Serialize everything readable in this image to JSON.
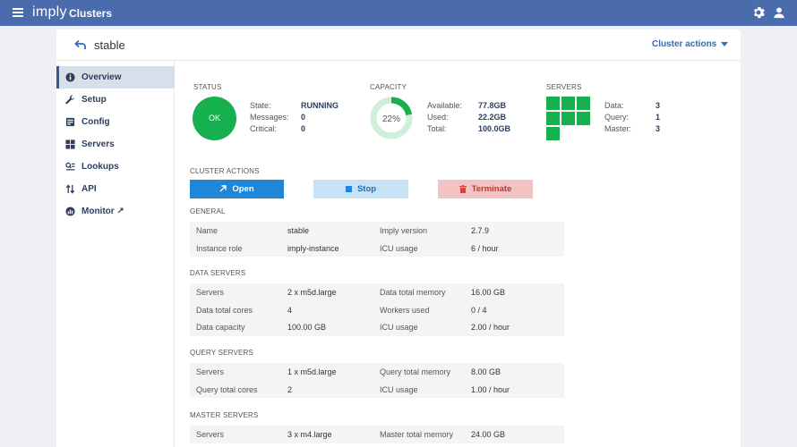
{
  "topbar": {
    "brand": "imply",
    "title": "Clusters",
    "bg": "#4a6bac"
  },
  "header": {
    "cluster_name": "stable",
    "cluster_actions_label": "Cluster actions"
  },
  "sidebar": {
    "items": [
      {
        "label": "Overview",
        "icon": "info-icon",
        "active": true
      },
      {
        "label": "Setup",
        "icon": "wrench-icon"
      },
      {
        "label": "Config",
        "icon": "config-icon"
      },
      {
        "label": "Servers",
        "icon": "servers-icon"
      },
      {
        "label": "Lookups",
        "icon": "lookups-icon"
      },
      {
        "label": "API",
        "icon": "api-icon"
      },
      {
        "label": "Monitor ↗",
        "icon": "monitor-icon"
      }
    ]
  },
  "status": {
    "label": "STATUS",
    "badge": "OK",
    "badge_color": "#16b04f",
    "rows": [
      {
        "k": "State:",
        "v": "RUNNING"
      },
      {
        "k": "Messages:",
        "v": "0"
      },
      {
        "k": "Critical:",
        "v": "0"
      }
    ]
  },
  "capacity": {
    "label": "CAPACITY",
    "percent_text": "22%",
    "percent": 22,
    "rows": [
      {
        "k": "Available:",
        "v": "77.8GB"
      },
      {
        "k": "Used:",
        "v": "22.2GB"
      },
      {
        "k": "Total:",
        "v": "100.0GB"
      }
    ]
  },
  "servers": {
    "label": "SERVERS",
    "rows": [
      {
        "k": "Data:",
        "v": "3"
      },
      {
        "k": "Query:",
        "v": "1"
      },
      {
        "k": "Master:",
        "v": "3"
      }
    ]
  },
  "actions": {
    "label": "CLUSTER ACTIONS",
    "open": "Open",
    "stop": "Stop",
    "terminate": "Terminate"
  },
  "general": {
    "label": "GENERAL",
    "rows": [
      [
        "Name",
        "stable",
        "Imply version",
        "2.7.9"
      ],
      [
        "Instance role",
        "imply-instance",
        "ICU usage",
        "6 / hour"
      ]
    ]
  },
  "data_servers": {
    "label": "DATA SERVERS",
    "rows": [
      [
        "Servers",
        "2 x m5d.large",
        "Data total memory",
        "16.00 GB"
      ],
      [
        "Data total cores",
        "4",
        "Workers used",
        "0 / 4"
      ],
      [
        "Data capacity",
        "100.00 GB",
        "ICU usage",
        "2.00 / hour"
      ]
    ]
  },
  "query_servers": {
    "label": "QUERY SERVERS",
    "rows": [
      [
        "Servers",
        "1 x m5d.large",
        "Query total memory",
        "8.00 GB"
      ],
      [
        "Query total cores",
        "2",
        "ICU usage",
        "1.00 / hour"
      ]
    ]
  },
  "master_servers": {
    "label": "MASTER SERVERS",
    "rows": [
      [
        "Servers",
        "3 x m4.large",
        "Master total memory",
        "24.00 GB"
      ]
    ]
  }
}
